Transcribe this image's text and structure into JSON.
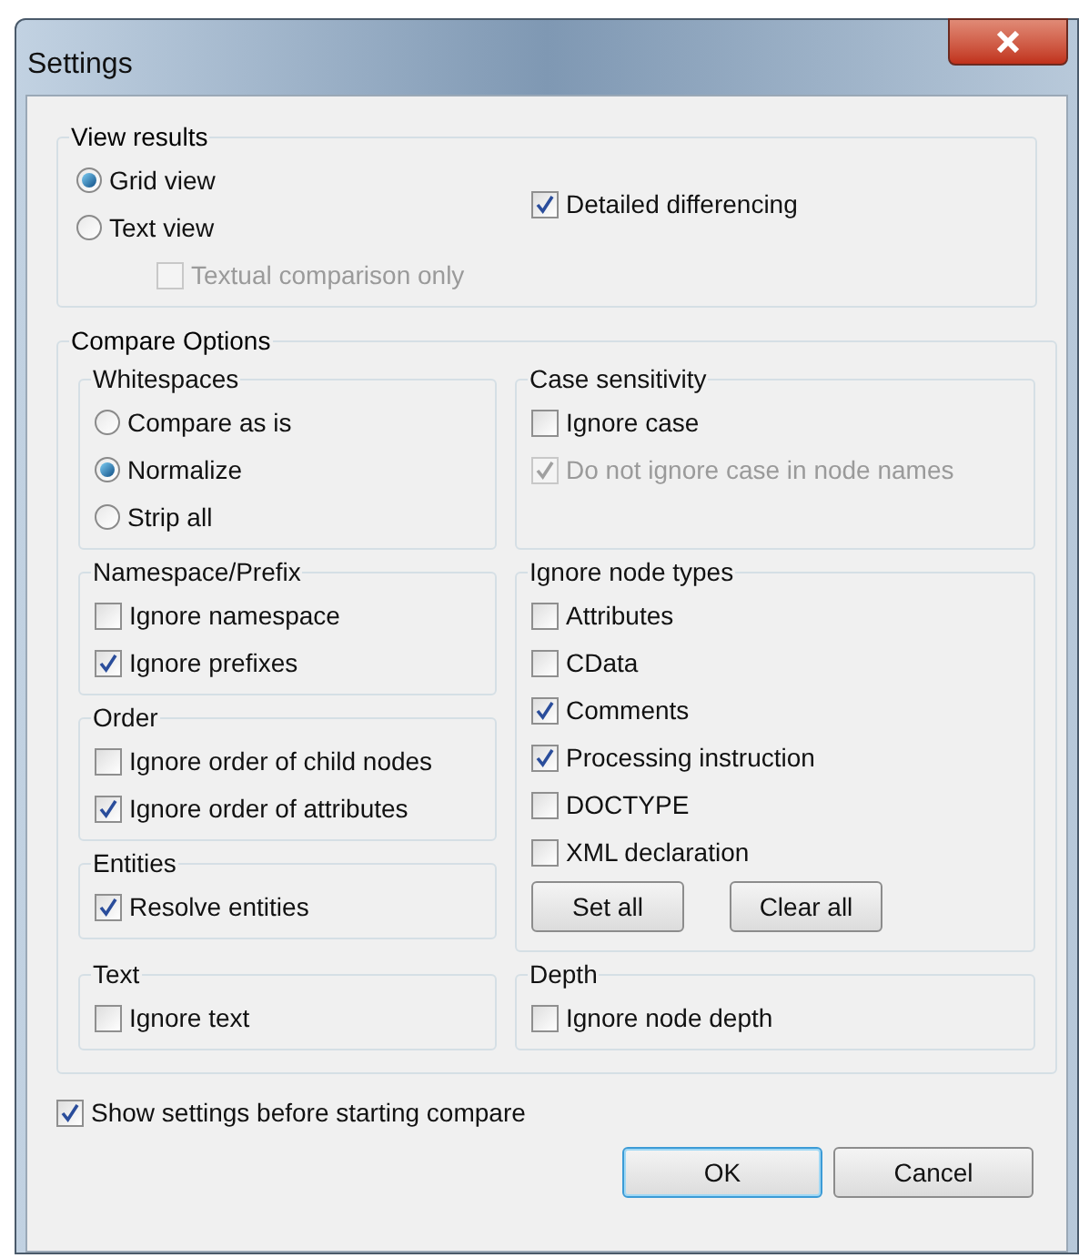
{
  "window": {
    "title": "Settings"
  },
  "view_results": {
    "title": "View results",
    "options": [
      {
        "kind": "radio",
        "label": "Grid view",
        "selected": true,
        "disabled": false
      },
      {
        "kind": "radio",
        "label": "Text view",
        "selected": false,
        "disabled": false,
        "children": [
          {
            "kind": "checkbox",
            "label": "Textual comparison only",
            "checked": false,
            "disabled": true
          }
        ]
      }
    ],
    "side_options": [
      {
        "kind": "checkbox",
        "label": "Detailed differencing",
        "checked": true,
        "disabled": false
      }
    ]
  },
  "compare_options": {
    "title": "Compare Options",
    "whitespaces": {
      "title": "Whitespaces",
      "items": [
        {
          "kind": "radio",
          "label": "Compare as is",
          "selected": false,
          "disabled": false
        },
        {
          "kind": "radio",
          "label": "Normalize",
          "selected": true,
          "disabled": false
        },
        {
          "kind": "radio",
          "label": "Strip all",
          "selected": false,
          "disabled": false
        }
      ]
    },
    "case_sensitivity": {
      "title": "Case sensitivity",
      "items": [
        {
          "kind": "checkbox",
          "label": "Ignore case",
          "checked": false,
          "disabled": false
        },
        {
          "kind": "checkbox",
          "label": "Do not ignore case in node names",
          "checked": true,
          "disabled": true
        }
      ]
    },
    "namespace_prefix": {
      "title": "Namespace/Prefix",
      "items": [
        {
          "kind": "checkbox",
          "label": "Ignore namespace",
          "checked": false,
          "disabled": false
        },
        {
          "kind": "checkbox",
          "label": "Ignore prefixes",
          "checked": true,
          "disabled": false
        }
      ]
    },
    "order": {
      "title": "Order",
      "items": [
        {
          "kind": "checkbox",
          "label": "Ignore order of child nodes",
          "checked": false,
          "disabled": false
        },
        {
          "kind": "checkbox",
          "label": "Ignore order of attributes",
          "checked": true,
          "disabled": false
        }
      ]
    },
    "entities": {
      "title": "Entities",
      "items": [
        {
          "kind": "checkbox",
          "label": "Resolve entities",
          "checked": true,
          "disabled": false
        }
      ]
    },
    "ignore_node_types": {
      "title": "Ignore node types",
      "items": [
        {
          "kind": "checkbox",
          "label": "Attributes",
          "checked": false,
          "disabled": false
        },
        {
          "kind": "checkbox",
          "label": "CData",
          "checked": false,
          "disabled": false
        },
        {
          "kind": "checkbox",
          "label": "Comments",
          "checked": true,
          "disabled": false
        },
        {
          "kind": "checkbox",
          "label": "Processing instruction",
          "checked": true,
          "disabled": false
        },
        {
          "kind": "checkbox",
          "label": "DOCTYPE",
          "checked": false,
          "disabled": false
        },
        {
          "kind": "checkbox",
          "label": "XML declaration",
          "checked": false,
          "disabled": false
        }
      ],
      "buttons": [
        "Set all",
        "Clear all"
      ]
    },
    "text": {
      "title": "Text",
      "items": [
        {
          "kind": "checkbox",
          "label": "Ignore text",
          "checked": false,
          "disabled": false
        }
      ]
    },
    "depth": {
      "title": "Depth",
      "items": [
        {
          "kind": "checkbox",
          "label": "Ignore node depth",
          "checked": false,
          "disabled": false
        }
      ]
    }
  },
  "show_settings": {
    "kind": "checkbox",
    "label": "Show settings before starting compare",
    "checked": true,
    "disabled": false
  },
  "buttons": [
    {
      "label": "OK",
      "default": true
    },
    {
      "label": "Cancel",
      "default": false
    }
  ]
}
